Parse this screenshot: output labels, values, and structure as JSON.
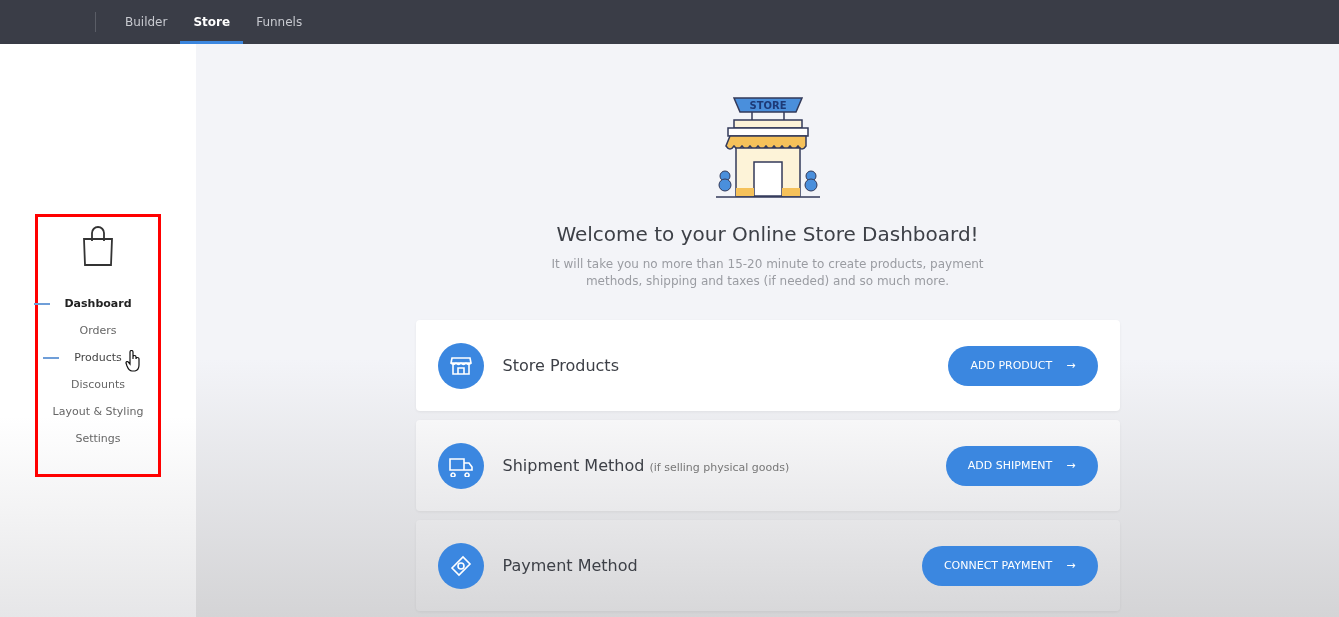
{
  "top_nav": {
    "tabs": [
      {
        "label": "Builder",
        "selected": false
      },
      {
        "label": "Store",
        "selected": true
      },
      {
        "label": "Funnels",
        "selected": false
      }
    ]
  },
  "sidebar": {
    "items": [
      {
        "label": "Dashboard",
        "selected": true,
        "hovered": false
      },
      {
        "label": "Orders",
        "selected": false,
        "hovered": false
      },
      {
        "label": "Products",
        "selected": false,
        "hovered": true
      },
      {
        "label": "Discounts",
        "selected": false,
        "hovered": false
      },
      {
        "label": "Layout & Styling",
        "selected": false,
        "hovered": false
      },
      {
        "label": "Settings",
        "selected": false,
        "hovered": false
      }
    ]
  },
  "hero": {
    "sign": "STORE",
    "title": "Welcome to your Online Store Dashboard!",
    "subtitle": "It will take you no more than 15-20 minute to create products, payment methods, shipping and taxes (if needed) and so much more."
  },
  "steps": [
    {
      "kind": "store",
      "title": "Store Products",
      "button": "ADD PRODUCT",
      "arrow": "→"
    },
    {
      "kind": "truck",
      "title": "Shipment Method",
      "note": "(if selling physical goods)",
      "button": "ADD SHIPMENT",
      "arrow": "→"
    },
    {
      "kind": "money",
      "title": "Payment Method",
      "button": "CONNECT PAYMENT",
      "arrow": "→"
    }
  ]
}
